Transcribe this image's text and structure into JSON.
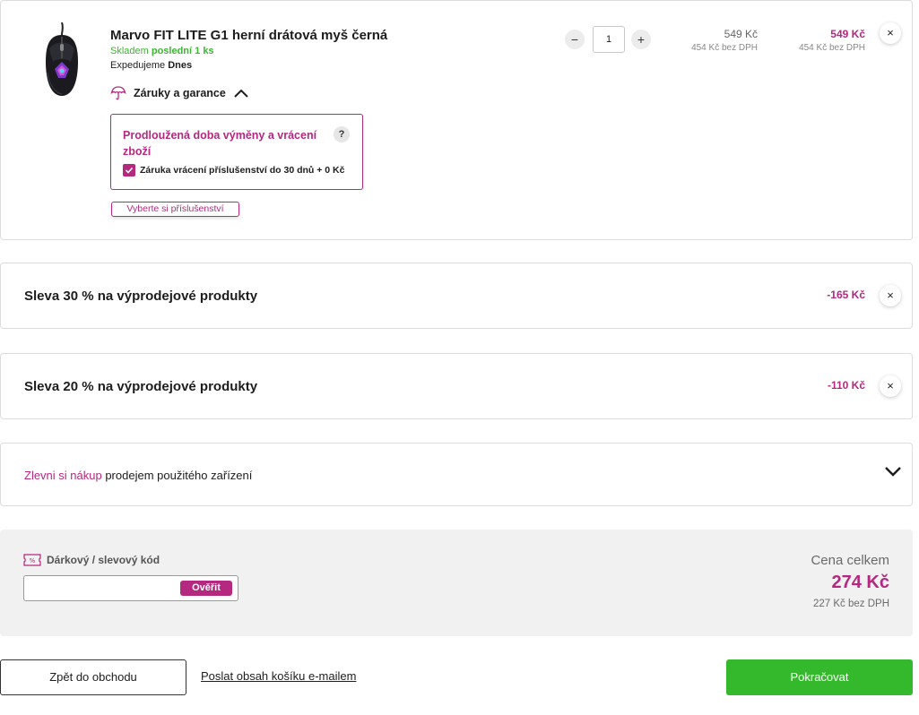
{
  "product": {
    "name": "Marvo FIT LITE G1 herní drátová myš černá",
    "stock_prefix": "Skladem",
    "stock_emphasis": "poslední 1 ks",
    "ship_prefix": "Expedujeme",
    "ship_day": "Dnes",
    "warranty_toggle_label": "Záruky a garance",
    "warranty_box_title": "Prodloužená doba výměny a vrácení zboží",
    "warranty_help": "?",
    "warranty_option": "Záruka vrácení příslušenství do 30 dnů + 0 Kč",
    "warranty_option_checked": true,
    "accessories_button": "Vyberte si příslušenství",
    "quantity": "1",
    "unit_price": "549 Kč",
    "unit_price_net": "454 Kč bez DPH",
    "total_price": "549 Kč",
    "total_price_net": "454 Kč bez DPH",
    "image_icon": "gaming-mouse-image"
  },
  "discounts": [
    {
      "label": "Sleva 30 % na výprodejové produkty",
      "value": "-165 Kč"
    },
    {
      "label": "Sleva 20 % na výprodejové produkty",
      "value": "-110 Kč"
    }
  ],
  "tradein": {
    "link_text": "Zlevni si nákup",
    "rest_text": " prodejem použitého zařízení"
  },
  "summary": {
    "coupon_label": "Dárkový / slevový kód",
    "coupon_value": "",
    "verify_button": "Ověřit",
    "total_label": "Cena celkem",
    "total_value": "274 Kč",
    "total_net": "227 Kč bez DPH"
  },
  "actions": {
    "back": "Zpět do obchodu",
    "email": "Poslat obsah košíku e-mailem",
    "continue": "Pokračovat"
  },
  "icons": {
    "remove": "×",
    "minus": "−",
    "plus": "+"
  },
  "colors": {
    "accent": "#b5287f",
    "success": "#35b92c",
    "stock": "#3cb531"
  }
}
